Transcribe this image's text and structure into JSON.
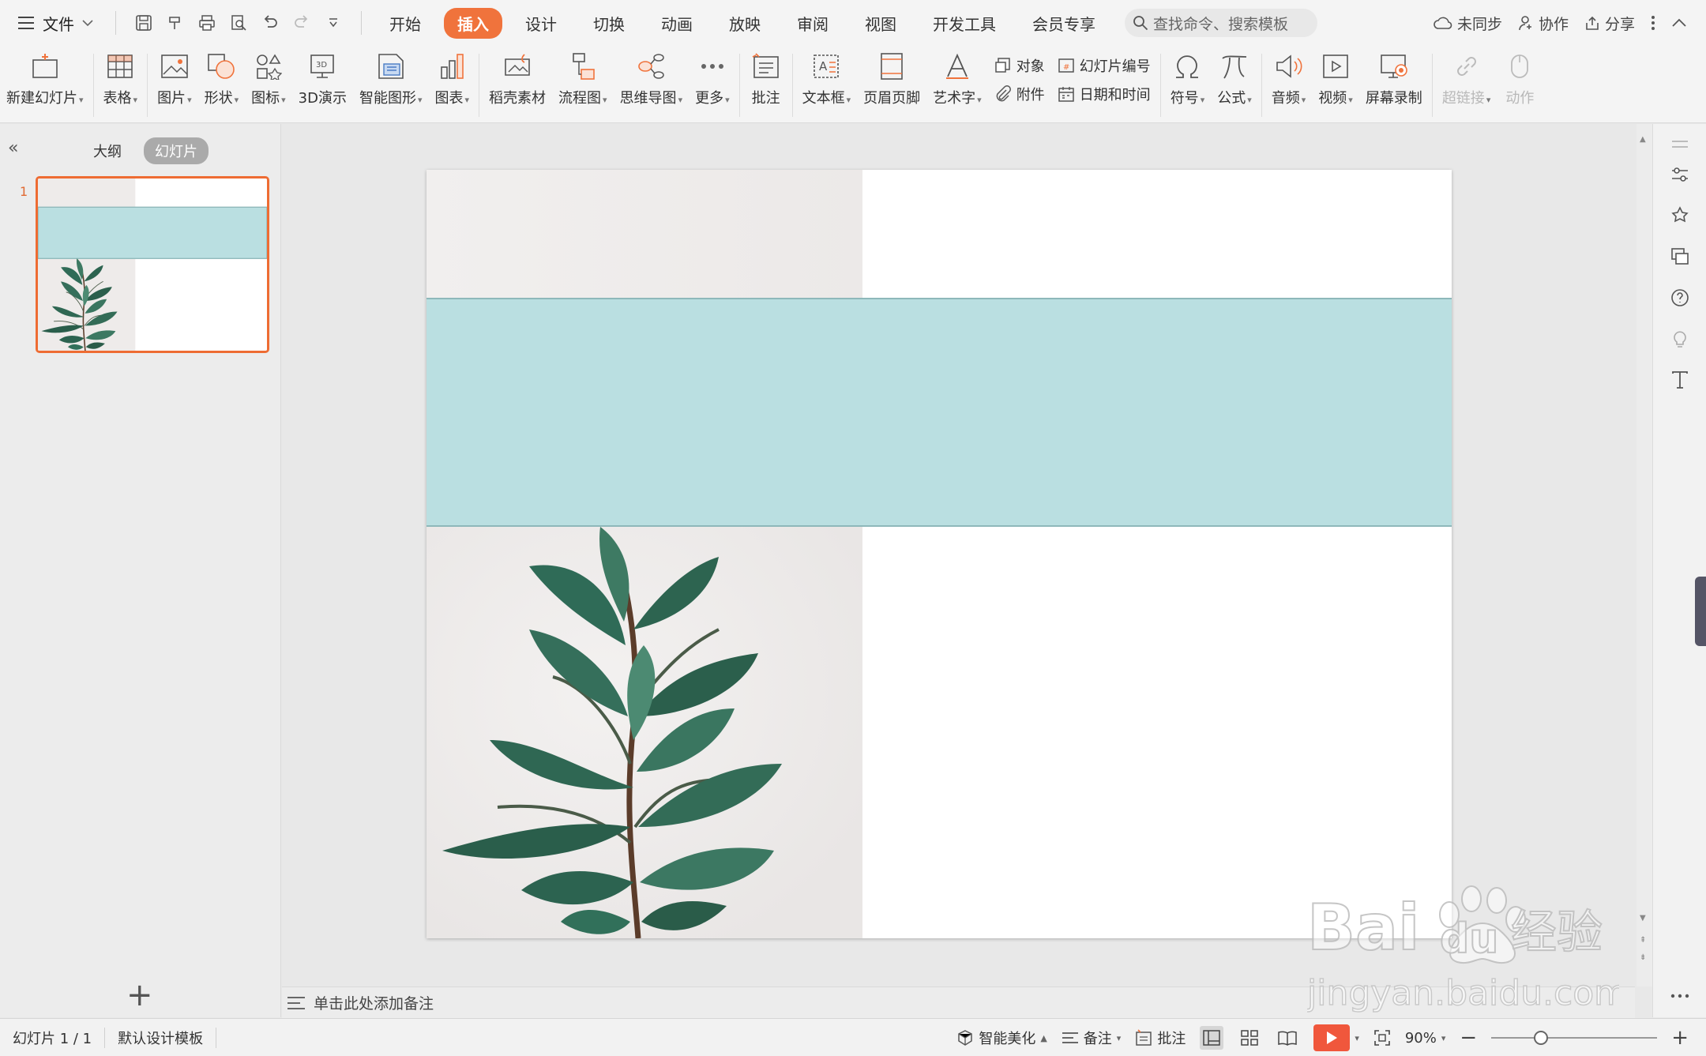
{
  "menubar": {
    "file_label": "文件",
    "tabs": [
      {
        "label": "开始",
        "active": false
      },
      {
        "label": "插入",
        "active": true
      },
      {
        "label": "设计",
        "active": false
      },
      {
        "label": "切换",
        "active": false
      },
      {
        "label": "动画",
        "active": false
      },
      {
        "label": "放映",
        "active": false
      },
      {
        "label": "审阅",
        "active": false
      },
      {
        "label": "视图",
        "active": false
      },
      {
        "label": "开发工具",
        "active": false
      },
      {
        "label": "会员专享",
        "active": false
      }
    ],
    "search_placeholder": "查找命令、搜索模板",
    "sync_label": "未同步",
    "collab_label": "协作",
    "share_label": "分享"
  },
  "ribbon": {
    "new_slide": "新建幻灯片",
    "table": "表格",
    "picture": "图片",
    "shape": "形状",
    "icon": "图标",
    "demo3d": "3D演示",
    "smartart": "智能图形",
    "chart": "图表",
    "material": "稻壳素材",
    "flowchart": "流程图",
    "mindmap": "思维导图",
    "more": "更多",
    "comment": "批注",
    "textbox": "文本框",
    "header_footer": "页眉页脚",
    "wordart": "艺术字",
    "object": "对象",
    "slide_number": "幻灯片编号",
    "attachment": "附件",
    "datetime": "日期和时间",
    "symbol": "符号",
    "formula": "公式",
    "audio": "音频",
    "video": "视频",
    "screen_record": "屏幕录制",
    "hyperlink": "超链接",
    "action": "动作"
  },
  "leftpanel": {
    "outline_tab": "大纲",
    "slides_tab": "幻灯片",
    "slide_number": "1"
  },
  "notes": {
    "placeholder": "单击此处添加备注"
  },
  "statusbar": {
    "slide_info": "幻灯片 1 / 1",
    "template": "默认设计模板",
    "beautify": "智能美化",
    "notes": "备注",
    "comments": "批注",
    "zoom": "90%",
    "zoom_fraction": 0.3
  },
  "colors": {
    "accent": "#f0733c",
    "band": "#badfe1",
    "thumb_border": "#ee6c33",
    "play": "#f0573c"
  }
}
